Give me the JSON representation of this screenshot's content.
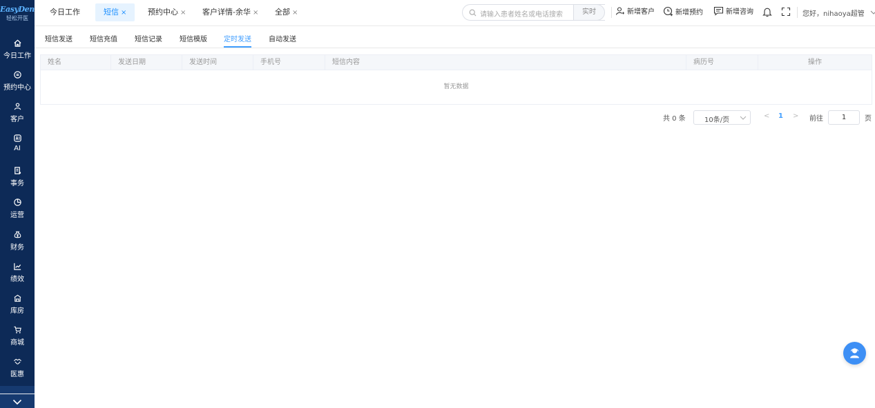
{
  "brand": {
    "name": "EasyDent",
    "subtitle": "轻松开医"
  },
  "sidebar": {
    "items": [
      {
        "label": "今日工作"
      },
      {
        "label": "预约中心"
      },
      {
        "label": "客户"
      },
      {
        "label": "AI"
      },
      {
        "label": "事务"
      },
      {
        "label": "运营"
      },
      {
        "label": "财务"
      },
      {
        "label": "绩效"
      },
      {
        "label": "库房"
      },
      {
        "label": "商城"
      },
      {
        "label": "医惠"
      }
    ]
  },
  "tabs": [
    {
      "label": "今日工作",
      "closable": false
    },
    {
      "label": "短信",
      "closable": true,
      "active": true
    },
    {
      "label": "预约中心",
      "closable": true
    },
    {
      "label": "客户详情-余华",
      "closable": true
    },
    {
      "label": "全部",
      "closable": true
    }
  ],
  "tab_close_glyph": "×",
  "search": {
    "placeholder": "请输入患者姓名或电话搜索",
    "button": "实时"
  },
  "header_actions": {
    "new_customer": "新增客户",
    "new_appointment": "新增预约",
    "new_consult": "新增咨询",
    "user_greeting": "您好，nihaoya超管"
  },
  "subtabs": [
    {
      "label": "短信发送"
    },
    {
      "label": "短信充值"
    },
    {
      "label": "短信记录"
    },
    {
      "label": "短信模版"
    },
    {
      "label": "定时发送",
      "active": true
    },
    {
      "label": "自动发送"
    }
  ],
  "table": {
    "columns": [
      "姓名",
      "发送日期",
      "发送时间",
      "手机号",
      "短信内容",
      "病历号",
      "操作"
    ],
    "empty_text": "暂无数据"
  },
  "pagination": {
    "total": "共 0 条",
    "page_size": "10条/页",
    "prev": "<",
    "current_page": "1",
    "next": ">",
    "goto_label": "前往",
    "goto_value": "1",
    "suffix": "页"
  },
  "colors": {
    "sidebar_bg": "#0d2a57",
    "accent": "#409eff",
    "float_button": "#3d8ff5"
  }
}
